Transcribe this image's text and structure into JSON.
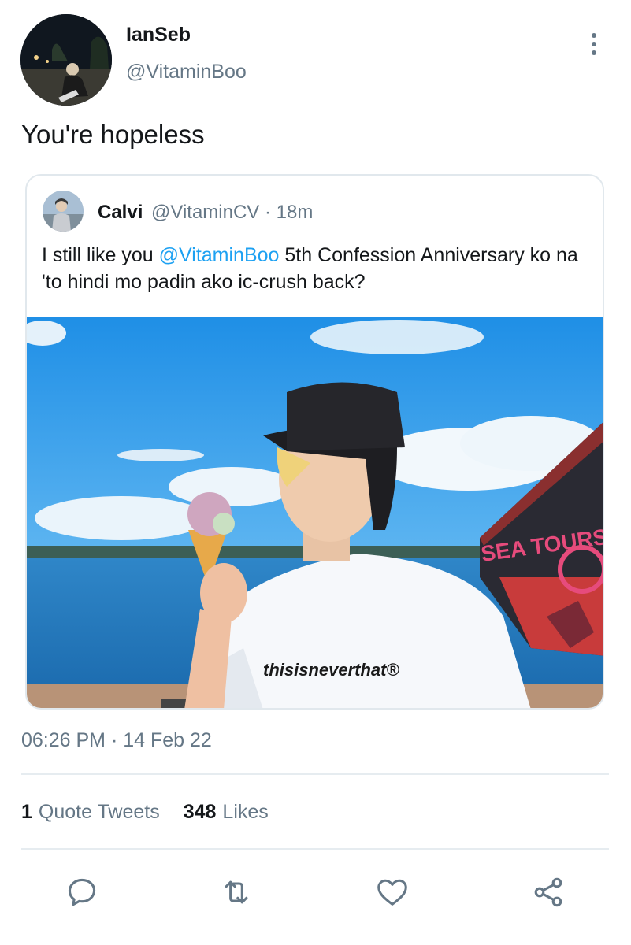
{
  "tweet": {
    "author_name": "IanSeb",
    "author_handle": "@VitaminBoo",
    "text": "You're hopeless",
    "timestamp": "06:26 PM · 14 Feb 22"
  },
  "quoted_tweet": {
    "author_name": "Calvi",
    "author_handle": "@VitaminCV",
    "separator": "·",
    "age": "18m",
    "text_before": "I still like you ",
    "mention": "@VitaminBoo",
    "text_after": " 5th Confession Anniversary ko na 'to hindi mo padin ako ic-crush back?",
    "image": {
      "shirt_text": "thisisneverthat®",
      "sign_text": "SEA TOURS"
    }
  },
  "stats": {
    "quote_tweets_count": "1",
    "quote_tweets_label": "Quote Tweets",
    "likes_count": "348",
    "likes_label": "Likes"
  },
  "actions": [
    {
      "name": "reply",
      "icon": "reply-icon"
    },
    {
      "name": "retweet",
      "icon": "retweet-icon"
    },
    {
      "name": "like",
      "icon": "heart-icon"
    },
    {
      "name": "share",
      "icon": "share-icon"
    }
  ],
  "colors": {
    "text_primary": "#14171a",
    "text_secondary": "#657786",
    "link": "#1da1f2",
    "border": "#e1e8ed"
  }
}
